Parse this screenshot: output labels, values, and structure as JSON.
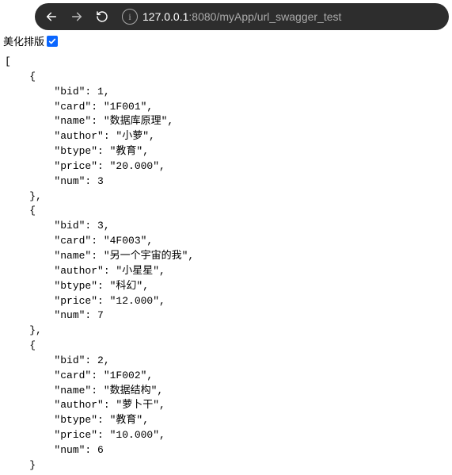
{
  "toolbar": {
    "url_host": "127.0.0.1",
    "url_port": ":8080",
    "url_path": "/myApp/url_swagger_test",
    "back_enabled": true,
    "forward_enabled": false
  },
  "top_control": {
    "label": "美化排版",
    "checked": true
  },
  "json_payload": [
    {
      "bid": 1,
      "card": "1F001",
      "name": "数据库原理",
      "author": "小萝",
      "btype": "教育",
      "price": "20.000",
      "num": 3
    },
    {
      "bid": 3,
      "card": "4F003",
      "name": "另一个宇宙的我",
      "author": "小星星",
      "btype": "科幻",
      "price": "12.000",
      "num": 7
    },
    {
      "bid": 2,
      "card": "1F002",
      "name": "数据结构",
      "author": "萝卜干",
      "btype": "教育",
      "price": "10.000",
      "num": 6
    }
  ],
  "field_order": [
    "bid",
    "card",
    "name",
    "author",
    "btype",
    "price",
    "num"
  ]
}
